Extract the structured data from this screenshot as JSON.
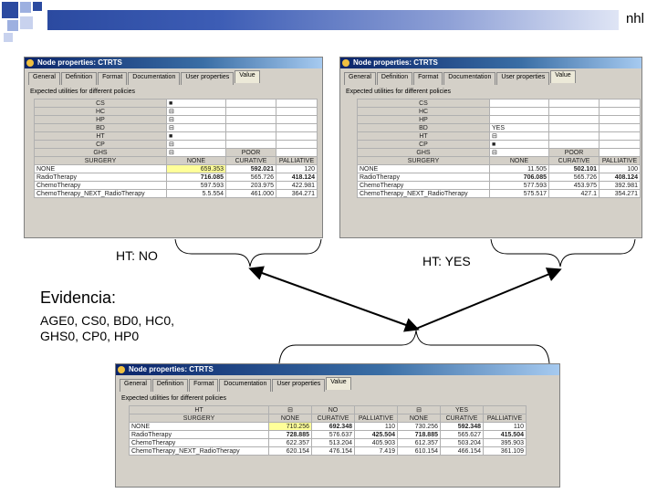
{
  "slide": {
    "corner_text": "nhl",
    "label_left": "HT: NO",
    "label_right": "HT: YES",
    "evidence_title": "Evidencia:",
    "evidence_line1": "AGE0, CS0, BD0, HC0,",
    "evidence_line2": "GHS0, CP0, HP0"
  },
  "windows": [
    {
      "title": "Node properties: CTRTS",
      "tabs": [
        "General",
        "Definition",
        "Format",
        "Documentation",
        "User properties",
        "Value"
      ],
      "caption": "Expected utilities for different policies",
      "rows": [
        [
          "CS",
          "",
          ""
        ],
        [
          "HC",
          "",
          ""
        ],
        [
          "HP",
          "",
          ""
        ],
        [
          "BD",
          "",
          ""
        ],
        [
          "HT",
          "",
          ""
        ],
        [
          "CP",
          "",
          ""
        ],
        [
          "GHS",
          "",
          "POOR"
        ],
        [
          "SURGERY",
          "NONE",
          "CURATIVE",
          "PALLIATIVE"
        ]
      ],
      "data": [
        [
          "NONE",
          "659.353",
          "592.021",
          "120"
        ],
        [
          "RadioTherapy",
          "716.085",
          "565.726",
          "418.124"
        ],
        [
          "ChemoTherapy",
          "597.593",
          "203.975",
          "422.981"
        ],
        [
          "ChemoTherapy_NEXT_RadioTherapy",
          "5.5.554",
          "461.000",
          "364.271"
        ]
      ]
    },
    {
      "title": "Node properties: CTRTS",
      "tabs": [
        "General",
        "Definition",
        "Format",
        "Documentation",
        "User properties",
        "Value"
      ],
      "caption": "Expected utilities for different policies",
      "rows": [
        [
          "CS",
          "",
          ""
        ],
        [
          "HC",
          "",
          ""
        ],
        [
          "HP",
          "",
          ""
        ],
        [
          "BD",
          "YES",
          ""
        ],
        [
          "HT",
          "",
          ""
        ],
        [
          "CP",
          "",
          ""
        ],
        [
          "GHS",
          "",
          "POOR"
        ],
        [
          "SURGERY",
          "NONE",
          "CURATIVE",
          "PALLIATIVE"
        ]
      ],
      "data": [
        [
          "NONE",
          "11.505",
          "502.101",
          "100"
        ],
        [
          "RadioTherapy",
          "706.085",
          "565.726",
          "408.124"
        ],
        [
          "ChemoTherapy",
          "577.593",
          "453.975",
          "392.981"
        ],
        [
          "ChemoTherapy_NEXT_RadioTherapy",
          "575.517",
          "427.1",
          "354.271"
        ]
      ]
    },
    {
      "title": "Node properties: CTRTS",
      "tabs": [
        "General",
        "Definition",
        "Format",
        "Documentation",
        "User properties",
        "Value"
      ],
      "caption": "Expected utilities for different policies",
      "header1": [
        "HT",
        "",
        "NO",
        "",
        "",
        "YES",
        ""
      ],
      "header2": [
        "SURGERY",
        "NONE",
        "CURATIVE",
        "PALLIATIVE",
        "NONE",
        "CURATIVE",
        "PALLIATIVE"
      ],
      "data": [
        [
          "NONE",
          "710.256",
          "692.348",
          "110",
          "730.256",
          "592.348",
          "110"
        ],
        [
          "RadioTherapy",
          "728.885",
          "576.637",
          "425.504",
          "718.885",
          "565.627",
          "415.504"
        ],
        [
          "ChemoTherapy",
          "622.357",
          "513.204",
          "405.903",
          "612.357",
          "503.204",
          "395.903"
        ],
        [
          "ChemoTherapy_NEXT_RadioTherapy",
          "620.154",
          "476.154",
          "7.419",
          "610.154",
          "466.154",
          "361.109"
        ]
      ]
    }
  ]
}
